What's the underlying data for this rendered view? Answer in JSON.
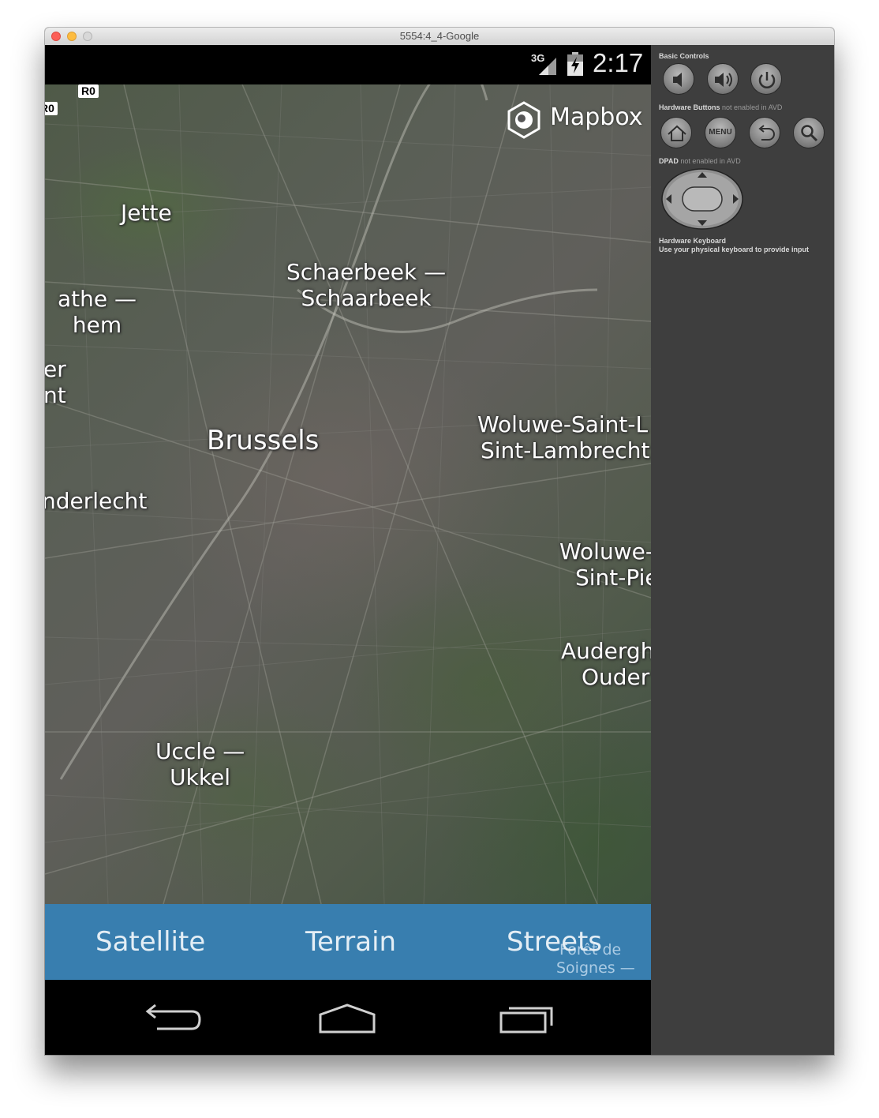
{
  "window": {
    "title": "5554:4_4-Google"
  },
  "statusbar": {
    "network": "3G",
    "time": "2:17"
  },
  "map": {
    "attribution": "Mapbox",
    "road_shields": [
      "R0",
      "R0"
    ],
    "labels": [
      {
        "id": "jette",
        "lines": [
          "Jette"
        ]
      },
      {
        "id": "schaerbeek",
        "lines": [
          "Schaerbeek —",
          "Schaarbeek"
        ]
      },
      {
        "id": "berchem",
        "lines": [
          "athe —",
          "hem"
        ]
      },
      {
        "id": "west-edge",
        "lines": [
          "er",
          "nt"
        ]
      },
      {
        "id": "brussels",
        "lines": [
          "Brussels"
        ]
      },
      {
        "id": "anderlecht",
        "lines": [
          "nderlecht"
        ]
      },
      {
        "id": "woluwe-lambert",
        "lines": [
          "Woluwe-Saint-L",
          "Sint-Lambrecht"
        ]
      },
      {
        "id": "woluwe-pierre",
        "lines": [
          "Woluwe-",
          "Sint-Pie"
        ]
      },
      {
        "id": "auderghem",
        "lines": [
          "Audergh",
          "Ouder"
        ]
      },
      {
        "id": "uccle",
        "lines": [
          "Uccle —",
          "Ukkel"
        ]
      }
    ],
    "ghost_labels": [
      "Forêt de",
      "Soignes —"
    ]
  },
  "layer_bar": {
    "satellite": "Satellite",
    "terrain": "Terrain",
    "streets": "Streets",
    "accent": "#3d89be"
  },
  "navbar": {
    "back_icon": "back-icon",
    "home_icon": "home-icon",
    "recents_icon": "recent-apps-icon"
  },
  "sidebar": {
    "basic_controls": "Basic Controls",
    "hardware_buttons": "Hardware Buttons",
    "hardware_buttons_note": "not enabled in AVD",
    "menu_label": "MENU",
    "dpad": "DPAD",
    "dpad_note": "not enabled in AVD",
    "hardware_keyboard": "Hardware Keyboard",
    "keyboard_note": "Use your physical keyboard to provide input"
  }
}
